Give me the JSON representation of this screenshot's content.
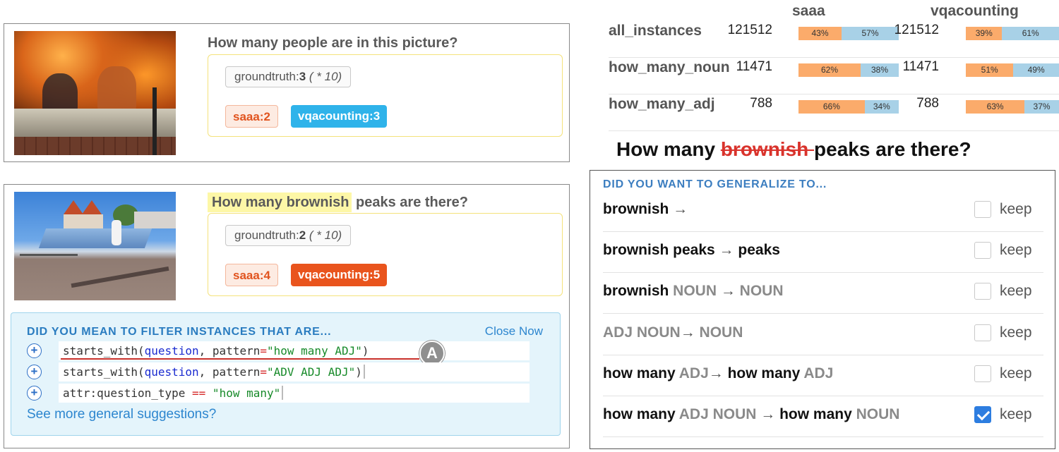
{
  "examples": [
    {
      "question": "How many people are in this picture?",
      "groundtruth_key": "groundtruth:",
      "groundtruth_value": "3",
      "groundtruth_weight": "( * 10)",
      "model_a": "saaa:2",
      "model_b": "vqacounting:3",
      "model_b_color": "#2fb3ea"
    },
    {
      "question_highlight": "How many brownish",
      "question_rest": " peaks are there?",
      "groundtruth_key": "groundtruth:",
      "groundtruth_value": "2",
      "groundtruth_weight": "( * 10)",
      "model_a": "saaa:4",
      "model_b": "vqacounting:5",
      "model_b_color": "#e9541d"
    }
  ],
  "suggestions": {
    "title": "DID YOU MEAN TO FILTER INSTANCES THAT ARE...",
    "close_label": "Close Now",
    "rows": [
      {
        "fn": "starts_with(",
        "arg": "question",
        "sep": ", pattern",
        "eq": "=",
        "value": "\"how many ADJ\"",
        "close": ")"
      },
      {
        "fn": "starts_with(",
        "arg": "question",
        "sep": ", pattern",
        "eq": "=",
        "value": "\"ADV ADJ ADJ\"",
        "close": ")"
      },
      {
        "fn": "attr:question_type ",
        "eq": "==",
        "value": " \"how many\""
      }
    ],
    "badge": "A",
    "see_more": "See more general suggestions?"
  },
  "stats": {
    "models": [
      "saaa",
      "vqacounting"
    ],
    "rows": [
      {
        "name": "all_instances",
        "counts": [
          "121512",
          "121512"
        ],
        "saaa": [
          43,
          57
        ],
        "vqacounting": [
          39,
          61
        ],
        "saaa_labels": [
          "43%",
          "57%"
        ],
        "vqa_labels": [
          "39%",
          "61%"
        ]
      },
      {
        "name": "how_many_noun",
        "counts": [
          "11471",
          "11471"
        ],
        "saaa": [
          62,
          38
        ],
        "vqacounting": [
          51,
          49
        ],
        "saaa_labels": [
          "62%",
          "38%"
        ],
        "vqa_labels": [
          "51%",
          "49%"
        ]
      },
      {
        "name": "how_many_adj",
        "counts": [
          "788",
          "788"
        ],
        "saaa": [
          66,
          34
        ],
        "vqacounting": [
          63,
          37
        ],
        "saaa_labels": [
          "66%",
          "34%"
        ],
        "vqa_labels": [
          "63%",
          "37%"
        ]
      }
    ],
    "colors": {
      "incorrect": "#fbab6b",
      "correct": "#a8d1e7"
    }
  },
  "heading": {
    "before": "How many ",
    "struck": "brownish ",
    "after": "peaks are there?"
  },
  "generalize": {
    "title": "DID YOU WANT TO GENERALIZE TO...",
    "keep_label": "keep",
    "rows": [
      {
        "parts": [
          [
            "dk",
            "brownish "
          ],
          [
            "arrow",
            "→"
          ]
        ],
        "checked": false
      },
      {
        "parts": [
          [
            "dk",
            "brownish peaks "
          ],
          [
            "arrow",
            "→"
          ],
          [
            "dk",
            " peaks"
          ]
        ],
        "checked": false
      },
      {
        "parts": [
          [
            "dk",
            "brownish "
          ],
          [
            "gr",
            "NOUN "
          ],
          [
            "arrow",
            "→"
          ],
          [
            "gr",
            " NOUN"
          ]
        ],
        "checked": false
      },
      {
        "parts": [
          [
            "gr",
            "ADJ NOUN"
          ],
          [
            "arrow",
            "→"
          ],
          [
            "gr",
            " NOUN"
          ]
        ],
        "checked": false
      },
      {
        "parts": [
          [
            "dk",
            "how many "
          ],
          [
            "gr",
            "ADJ"
          ],
          [
            "arrow",
            "→"
          ],
          [
            "dk",
            " how many "
          ],
          [
            "gr",
            "ADJ"
          ]
        ],
        "checked": false
      },
      {
        "parts": [
          [
            "dk",
            "how many "
          ],
          [
            "gr",
            "ADJ NOUN "
          ],
          [
            "arrow",
            "→"
          ],
          [
            "dk",
            " how many "
          ],
          [
            "gr",
            "NOUN"
          ]
        ],
        "checked": true
      }
    ]
  }
}
